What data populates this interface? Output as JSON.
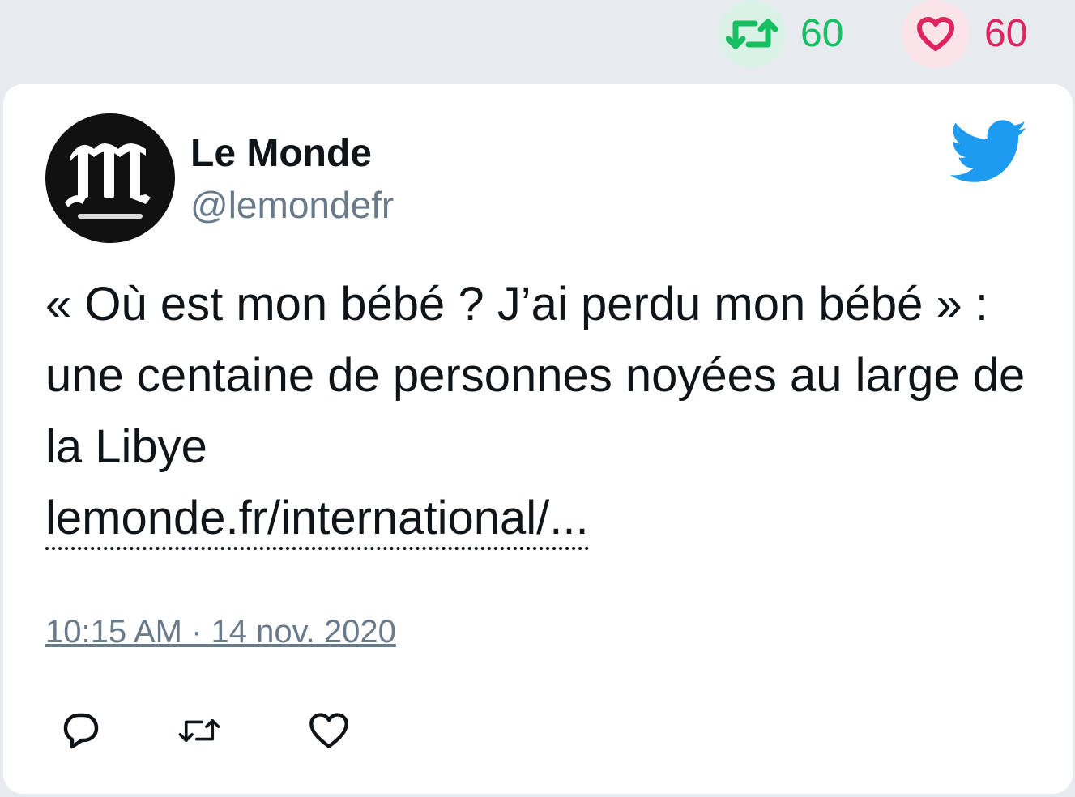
{
  "stats": {
    "retweet_icon": "retweet-icon",
    "retweet_count": "60",
    "like_icon": "heart-icon",
    "like_count": "60"
  },
  "tweet": {
    "author_name": "Le Monde",
    "author_handle": "@lemondefr",
    "avatar_logo_text": "Le Monde",
    "text": "« Où est mon bébé ? J’ai perdu mon bébé » : une centaine de personnes noyées au large de la Libye",
    "link_text": "lemonde.fr/international/...",
    "timestamp": "10:15 AM · 14 nov. 2020"
  },
  "actions": {
    "reply_icon": "reply-icon",
    "retweet_icon": "retweet-icon",
    "like_icon": "heart-icon"
  },
  "colors": {
    "retweet_green": "#17bf63",
    "like_red": "#e0245e",
    "twitter_blue": "#1d9bf0",
    "muted_gray": "#697a8a",
    "page_background": "#e7eaee"
  }
}
